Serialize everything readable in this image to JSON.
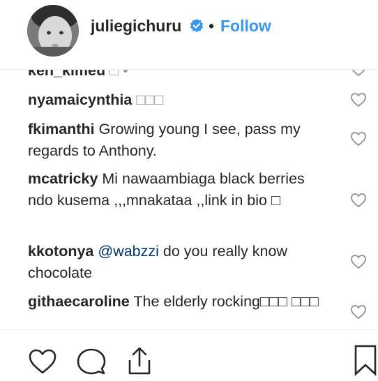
{
  "header": {
    "username": "juliegichuru",
    "separator": "•",
    "follow_label": "Follow"
  },
  "comments": [
    {
      "user": "ken_kimeu",
      "text": "",
      "partial": true
    },
    {
      "user": "nyamaicynthia",
      "text": "□□□"
    },
    {
      "user": "fkimanthi",
      "text": "Growing young I see, pass my regards to Anthony."
    },
    {
      "user": "mcatricky",
      "text": "Mi nawaambiaga black berries ndo kusema ,,,mnakataa ,,link in bio □"
    },
    {
      "user": "kkotonya",
      "mention": "@wabzzi",
      "text": "do you really know chocolate"
    },
    {
      "user": "githaecaroline",
      "text": "The elderly rocking□□□ □□□"
    }
  ],
  "icons": {
    "verified": "verified-badge-icon",
    "like": "heart-icon",
    "comment": "comment-bubble-icon",
    "share": "share-icon",
    "save": "bookmark-icon"
  },
  "colors": {
    "link": "#3897f0",
    "verified": "#3897f0",
    "text": "#262626",
    "mention": "#003569"
  }
}
